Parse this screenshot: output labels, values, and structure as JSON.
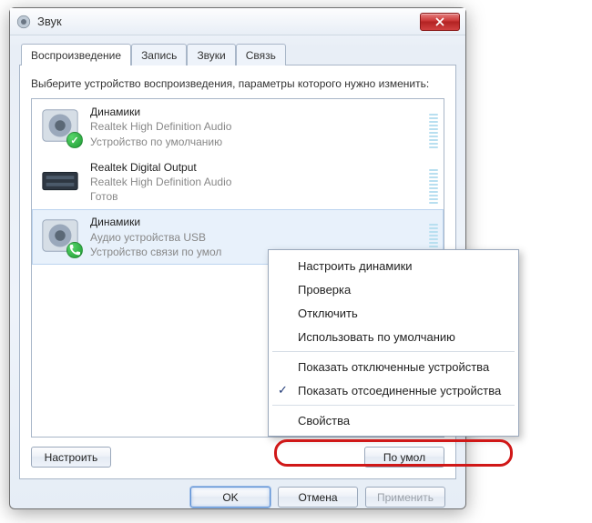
{
  "window": {
    "title": "Звук"
  },
  "tabs": [
    {
      "label": "Воспроизведение",
      "active": true
    },
    {
      "label": "Запись"
    },
    {
      "label": "Звуки"
    },
    {
      "label": "Связь"
    }
  ],
  "instruction": "Выберите устройство воспроизведения, параметры которого нужно изменить:",
  "devices": [
    {
      "title": "Динамики",
      "subtitle": "Realtek High Definition Audio",
      "status": "Устройство по умолчанию",
      "badge": "check",
      "icon": "speaker"
    },
    {
      "title": "Realtek Digital Output",
      "subtitle": "Realtek High Definition Audio",
      "status": "Готов",
      "badge": "",
      "icon": "spdif"
    },
    {
      "title": "Динамики",
      "subtitle": "Аудио устройства USB",
      "status": "Устройство связи по умол",
      "badge": "phone",
      "icon": "speaker",
      "selected": true
    }
  ],
  "panel_buttons": {
    "configure": "Настроить",
    "default": "По умол"
  },
  "bottom": {
    "ok": "OK",
    "cancel": "Отмена",
    "apply": "Применить"
  },
  "context_menu": {
    "items": [
      {
        "label": "Настроить динамики"
      },
      {
        "label": "Проверка"
      },
      {
        "label": "Отключить"
      },
      {
        "label": "Использовать по умолчанию"
      },
      {
        "sep": true
      },
      {
        "label": "Показать отключенные устройства"
      },
      {
        "label": "Показать отсоединенные устройства",
        "checked": true
      },
      {
        "sep": true
      },
      {
        "label": "Свойства",
        "highlighted": true
      }
    ]
  }
}
